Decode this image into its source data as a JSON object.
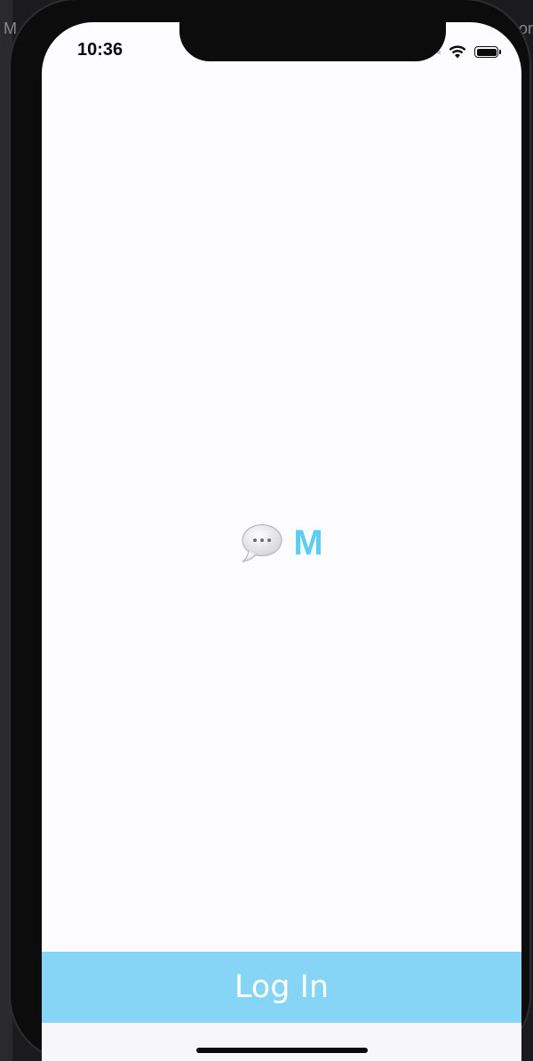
{
  "backdrop": {
    "left_letter": "M",
    "right_letter": "or"
  },
  "status_bar": {
    "time": "10:36",
    "icons": [
      "signal-dots-icon",
      "wifi-icon",
      "battery-icon"
    ]
  },
  "logo": {
    "emoji_icon": "speech-balloon-icon",
    "letter": "M",
    "letter_color": "#5bcdf2"
  },
  "login_button": {
    "label": "Log In",
    "background": "#86d4f6",
    "text_color": "#ffffff"
  }
}
